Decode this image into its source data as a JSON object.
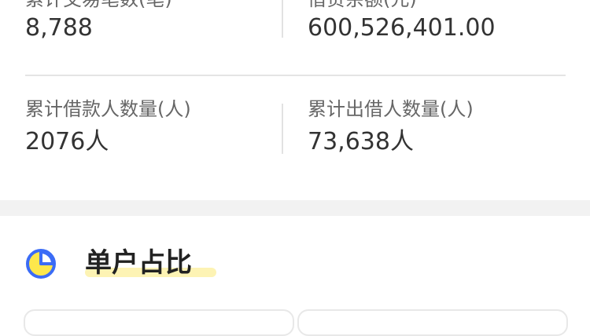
{
  "stats": {
    "row1": [
      {
        "label": "累计交易笔数(笔)",
        "value": "8,788"
      },
      {
        "label": "借贷余额(元)",
        "value": "600,526,401.00"
      }
    ],
    "row2": [
      {
        "label": "累计借款人数量(人)",
        "value": "2076人"
      },
      {
        "label": "累计出借人数量(人)",
        "value": "73,638人"
      }
    ]
  },
  "section": {
    "title": "单户占比",
    "icon": "pie-chart-icon"
  },
  "colors": {
    "accent_blue": "#3b6cf6",
    "accent_yellow": "#fde74c",
    "highlight": "#fdf3b4"
  }
}
